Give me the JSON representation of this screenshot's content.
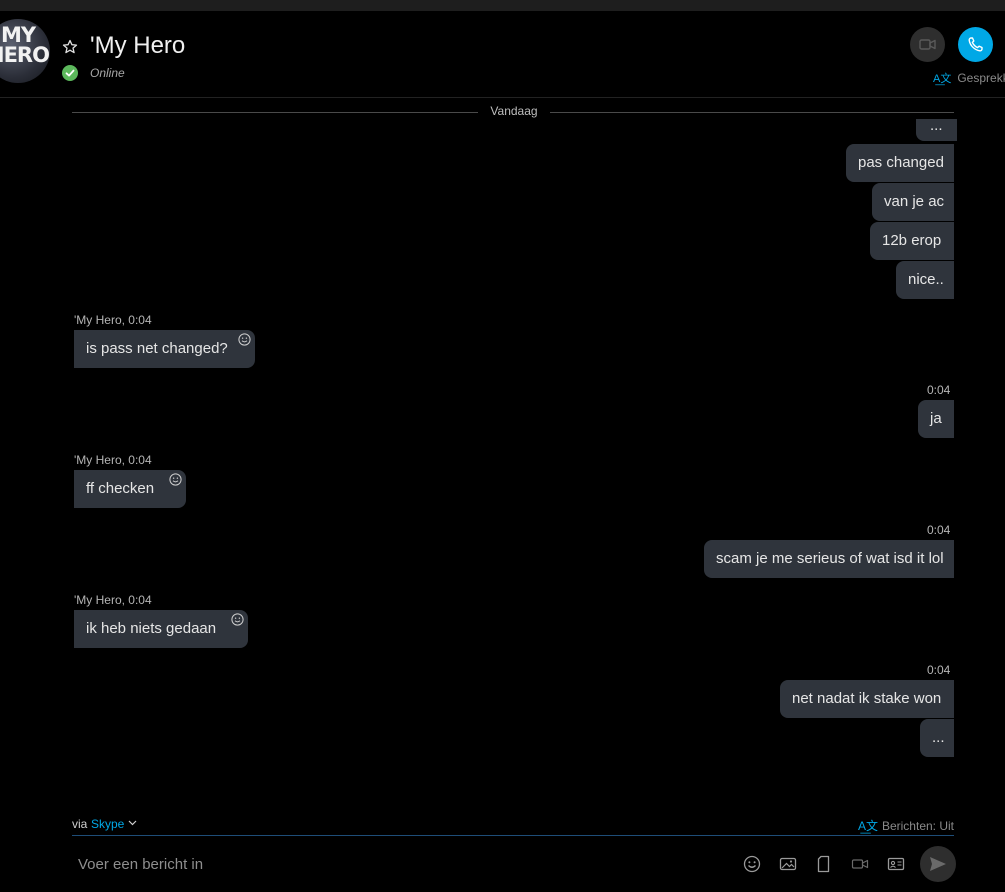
{
  "header": {
    "avatar_text_line1": "MY",
    "avatar_text_line2": "HERO",
    "contact_name": "'My Hero",
    "status": "Online",
    "translate_label": "Gesprekk"
  },
  "divider": {
    "label": "Vandaag"
  },
  "messages": {
    "out_group1": [
      "...",
      "pas changed",
      "van je ac",
      "12b erop",
      "nice.."
    ],
    "in1": {
      "sender_time": "'My Hero, 0:04",
      "text": "is pass net changed?"
    },
    "out2": {
      "time": "0:04",
      "text": "ja"
    },
    "in2": {
      "sender_time": "'My Hero, 0:04",
      "text": "ff checken"
    },
    "out3": {
      "time": "0:04",
      "text": "scam je me serieus of wat isd it lol"
    },
    "in3": {
      "sender_time": "'My Hero, 0:04",
      "text": "ik heb niets gedaan"
    },
    "out4": {
      "time": "0:04",
      "texts": [
        "net nadat ik stake won",
        "..."
      ]
    }
  },
  "composer": {
    "via_label": "via",
    "via_service": "Skype",
    "translate_status": "Berichten: Uit",
    "placeholder": "Voer een bericht in"
  },
  "colors": {
    "accent": "#00a8e6",
    "online": "#5cb85c",
    "bubble": "#2f343c",
    "background": "#000000"
  }
}
